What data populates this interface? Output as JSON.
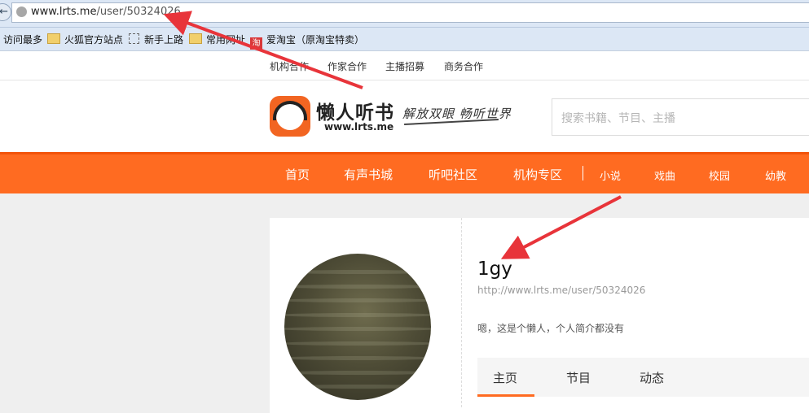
{
  "browser": {
    "url_host": "www.lrts.me",
    "url_path": "/user/50324026",
    "back_glyph": "←"
  },
  "bookmarks": [
    {
      "label": "访问最多",
      "icon": "none"
    },
    {
      "label": "火狐官方站点",
      "icon": "folder-icon"
    },
    {
      "label": "新手上路",
      "icon": "dotted-box-icon"
    },
    {
      "label": "常用网址",
      "icon": "folder-icon"
    },
    {
      "label": "爱淘宝（原淘宝特卖）",
      "icon": "taobao-icon",
      "icon_text": "淘"
    }
  ],
  "top_links": [
    "机构合作",
    "作家合作",
    "主播招募",
    "商务合作"
  ],
  "header": {
    "site_name": "懒人听书",
    "site_url": "www.lrts.me",
    "slogan": "解放双眼 畅听世界",
    "search_placeholder": "搜索书籍、节目、主播"
  },
  "nav": {
    "main": [
      "首页",
      "有声书城",
      "听吧社区",
      "机构专区"
    ],
    "sub": [
      "小说",
      "戏曲",
      "校园",
      "幼教"
    ]
  },
  "profile": {
    "username": "1gy",
    "profile_url": "http://www.lrts.me/user/50324026",
    "bio": "嗯，这是个懒人，个人简介都没有",
    "tabs": [
      "主页",
      "节目",
      "动态"
    ],
    "active_tab": "主页"
  },
  "colors": {
    "accent": "#ff6b21",
    "annotation_arrow": "#e8343a"
  }
}
